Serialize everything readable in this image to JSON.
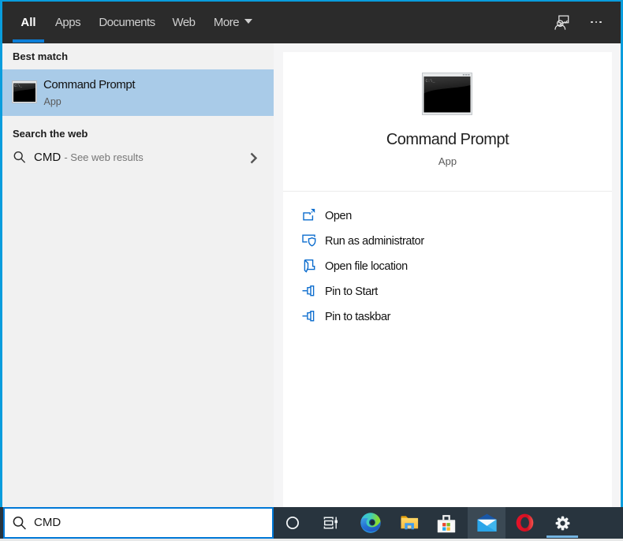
{
  "colors": {
    "window_border": "#099ddd",
    "accent": "#0078d7",
    "header_bg": "#2b2b2b",
    "best_match_highlight": "#a9cbe8",
    "action_icon_blue": "#0b6cce",
    "taskbar_bg": "#28343e",
    "taskbar_running_underline": "#75b5e2"
  },
  "header": {
    "tabs": [
      {
        "label": "All",
        "active": true
      },
      {
        "label": "Apps",
        "active": false
      },
      {
        "label": "Documents",
        "active": false
      },
      {
        "label": "Web",
        "active": false
      },
      {
        "label": "More",
        "active": false
      }
    ],
    "icons": [
      "feedback-icon",
      "more-options-icon"
    ]
  },
  "results": {
    "best_match_label": "Best match",
    "best_match": {
      "title": "Command Prompt",
      "type": "App"
    },
    "web_label": "Search the web",
    "web_row": {
      "query": "CMD",
      "hint": "- See web results"
    }
  },
  "preview": {
    "title": "Command Prompt",
    "type": "App",
    "actions": [
      {
        "label": "Open",
        "icon": "open-icon"
      },
      {
        "label": "Run as administrator",
        "icon": "admin-shield-icon"
      },
      {
        "label": "Open file location",
        "icon": "file-location-icon"
      },
      {
        "label": "Pin to Start",
        "icon": "pin-icon"
      },
      {
        "label": "Pin to taskbar",
        "icon": "pin-icon"
      }
    ]
  },
  "search_box": {
    "value": "CMD"
  },
  "taskbar": {
    "items": [
      "cortana",
      "task-view",
      "edge",
      "file-explorer",
      "microsoft-store",
      "mail",
      "opera",
      "settings"
    ],
    "hovered_item": "mail",
    "running_item": "settings"
  }
}
